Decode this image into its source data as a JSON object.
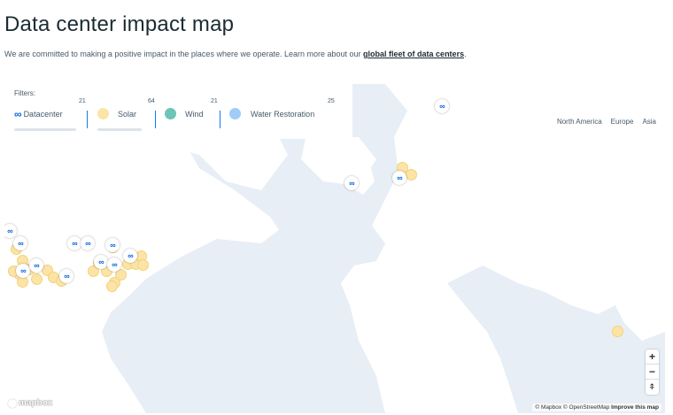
{
  "page": {
    "title": "Data center impact map",
    "intro_text": "We are committed to making a positive impact in the places where we operate. Learn more about our ",
    "intro_link": "global fleet of data centers",
    "intro_end": "."
  },
  "filters": {
    "label": "Filters:",
    "items": [
      {
        "label": "Datacenter",
        "count": "21",
        "icon": "meta-logo-icon",
        "color": "#0064e0"
      },
      {
        "label": "Solar",
        "count": "64",
        "icon": "solar-dot-icon",
        "color": "#fbe4a6"
      },
      {
        "label": "Wind",
        "count": "21",
        "icon": "wind-dot-icon",
        "color": "#6cc5b7"
      },
      {
        "label": "Water Restoration",
        "count": "25",
        "icon": "water-dot-icon",
        "color": "#9fcdf7"
      }
    ]
  },
  "regions": [
    "North America",
    "Europe",
    "Asia"
  ],
  "marker_glyph": "∞",
  "zoom": {
    "in": "+",
    "out": "−",
    "compass": "⍏"
  },
  "map_footer": {
    "logo": "mapbox",
    "attribution": "© Mapbox © OpenStreetMap ",
    "improve": "Improve this map"
  },
  "colors": {
    "land": "#ffffff",
    "water": "#e8eef6",
    "accent": "#0064e0"
  }
}
